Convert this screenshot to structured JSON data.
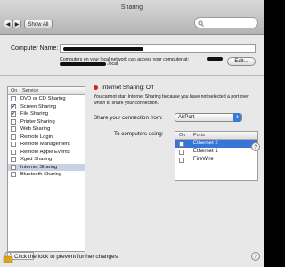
{
  "window": {
    "title": "Sharing"
  },
  "toolbar": {
    "back": "◀",
    "forward": "▶",
    "show_all": "Show All"
  },
  "computer_name": {
    "label": "Computer Name:",
    "info": "Computers on your local network can access your computer at:",
    "local_suffix": ".local",
    "edit_label": "Edit..."
  },
  "services": {
    "header_on": "On",
    "header_service": "Service",
    "items": [
      {
        "label": "DVD or CD Sharing",
        "checked": false,
        "selected": false
      },
      {
        "label": "Screen Sharing",
        "checked": true,
        "selected": false
      },
      {
        "label": "File Sharing",
        "checked": true,
        "selected": false
      },
      {
        "label": "Printer Sharing",
        "checked": false,
        "selected": false
      },
      {
        "label": "Web Sharing",
        "checked": false,
        "selected": false
      },
      {
        "label": "Remote Login",
        "checked": false,
        "selected": false
      },
      {
        "label": "Remote Management",
        "checked": false,
        "selected": false
      },
      {
        "label": "Remote Apple Events",
        "checked": false,
        "selected": false
      },
      {
        "label": "Xgrid Sharing",
        "checked": false,
        "selected": false
      },
      {
        "label": "Internet Sharing",
        "checked": false,
        "selected": true
      },
      {
        "label": "Bluetooth Sharing",
        "checked": false,
        "selected": false
      }
    ]
  },
  "internet_sharing": {
    "status": "Internet Sharing: Off",
    "description_line1": "You cannot start Internet Sharing because you have not selected a port over",
    "description_line2": "which to share your connection.",
    "share_from_label": "Share your connection from:",
    "share_from_value": "AirPort",
    "to_computers_label": "To computers using:",
    "ports_header_on": "On",
    "ports_header_ports": "Ports",
    "ports": [
      {
        "label": "Ethernet 2",
        "checked": false,
        "selected": true
      },
      {
        "label": "Ethernet 1",
        "checked": false,
        "selected": false
      },
      {
        "label": "FireWire",
        "checked": false,
        "selected": false
      }
    ]
  },
  "footer": {
    "lock_text": "Click the lock to prevent further changes.",
    "help": "?"
  },
  "colors": {
    "status_off": "#d42020",
    "selection": "#3875d7"
  },
  "icons": [
    "back-arrow-icon",
    "forward-arrow-icon",
    "search-icon",
    "lock-icon",
    "help-icon",
    "popup-arrows-icon",
    "checkmark-icon"
  ]
}
